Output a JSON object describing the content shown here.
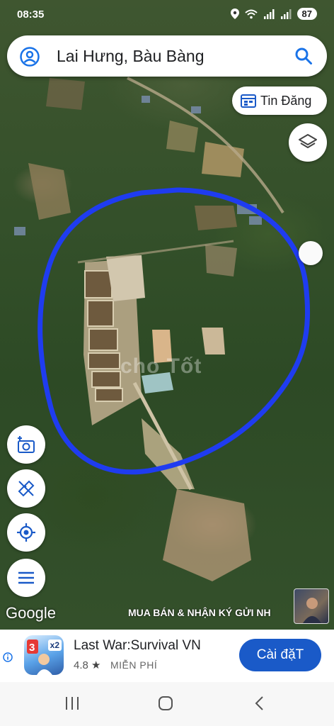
{
  "status": {
    "time": "08:35",
    "battery": "87"
  },
  "search": {
    "query": "Lai Hưng, Bàu Bàng"
  },
  "post_button": {
    "label": "Tin Đăng"
  },
  "map": {
    "attribution": "Google",
    "watermark": "MUA BÁN & NHẬN KÝ GỬI NH",
    "center_watermark": "cho Tốt",
    "circle_color": "#1f3cf0"
  },
  "icons": {
    "account": "account-circle-icon",
    "search": "search-icon",
    "post": "calendar-list-icon",
    "layers": "layers-icon",
    "camera": "add-photo-icon",
    "measure": "ruler-icon",
    "location": "my-location-icon",
    "menu": "menu-icon"
  },
  "ad": {
    "app_name": "Last War:Survival VN",
    "rating": "4.8",
    "price": "MIỄN PHÍ",
    "install_label": "Cài đặT",
    "badge": "x2",
    "accent": "#1a5ac8"
  }
}
